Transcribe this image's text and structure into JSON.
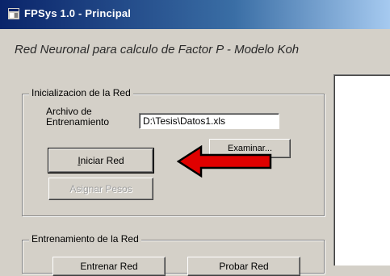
{
  "window": {
    "title": "FPSys 1.0 - Principal",
    "subtitle": "Red Neuronal para calculo de Factor P - Modelo Koh"
  },
  "init_group": {
    "legend": "Inicializacion de la Red",
    "file_label_line1": "Archivo de",
    "file_label_line2": "Entrenamiento",
    "file_value": "D:\\Tesis\\Datos1.xls",
    "browse_label": "Examinar...",
    "start_prefix": "",
    "start_mnemonic": "I",
    "start_rest": "niciar Red",
    "assign_label": "Asignar Pesos"
  },
  "train_group": {
    "legend": "Entrenamiento de la Red",
    "btn1_label": "Entrenar Red",
    "btn2_label": "Probar Red"
  },
  "colors": {
    "title_bar": "#0a246a",
    "face": "#d4d0c8",
    "arrow_fill": "#e00000"
  },
  "icons": {
    "window_icon": "app-icon",
    "annotation": "red-arrow-left"
  }
}
